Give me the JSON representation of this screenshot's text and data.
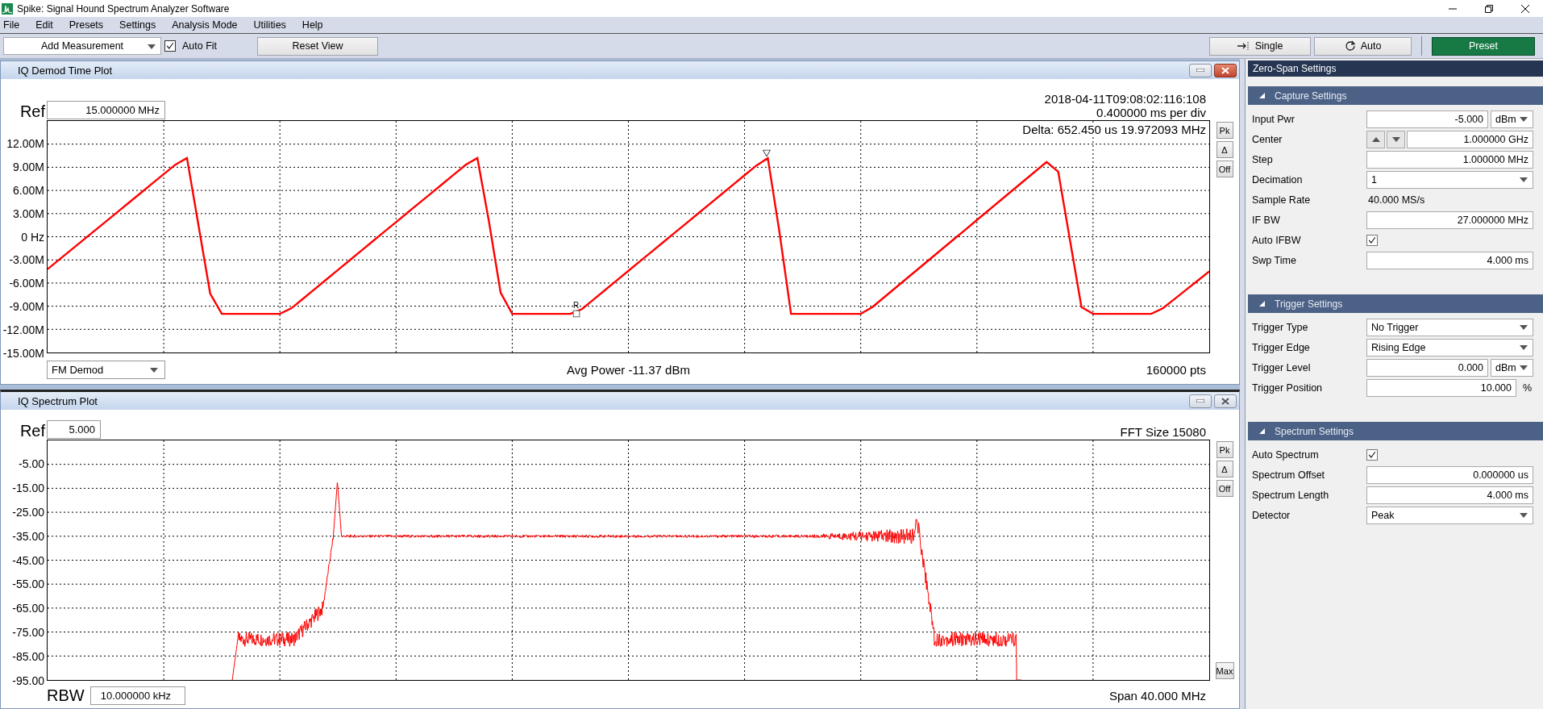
{
  "window": {
    "title": "Spike: Signal Hound Spectrum Analyzer Software"
  },
  "menu": [
    "File",
    "Edit",
    "Presets",
    "Settings",
    "Analysis Mode",
    "Utilities",
    "Help"
  ],
  "toolbar": {
    "measurement": "Add Measurement",
    "auto_fit": {
      "label": "Auto Fit",
      "checked": true
    },
    "reset": "Reset View",
    "single": "Single",
    "auto": "Auto",
    "preset": "Preset"
  },
  "plots": [
    {
      "title": "IQ Demod Time Plot",
      "active": true,
      "ref_label": "Ref",
      "ref_value": "15.000000 MHz",
      "header_lines": [
        "2018-04-11T09:08:02:116:108",
        "0.400000 ms per div"
      ],
      "annotation": "Delta: 652.450 us 19.972093 MHz",
      "chart_data": {
        "type": "line",
        "grid": true,
        "categories": [
          null,
          null,
          null,
          null,
          null,
          null,
          null,
          null,
          null,
          null,
          null,
          null,
          null,
          null,
          null,
          null,
          null,
          null,
          null,
          null,
          null,
          null,
          null,
          null,
          null,
          null,
          null,
          null,
          null,
          null,
          null,
          null,
          null,
          null,
          null,
          null,
          null,
          null,
          null,
          null,
          null,
          null,
          null,
          null,
          null,
          null,
          null,
          null,
          null,
          null,
          null,
          null,
          null,
          null,
          null,
          null,
          null,
          null,
          null,
          null,
          null,
          null,
          null,
          null,
          null,
          null,
          null,
          null,
          null,
          null,
          null,
          null,
          null,
          null,
          null,
          null,
          null,
          null,
          null,
          null,
          null,
          null,
          null,
          null,
          null,
          null,
          null,
          null,
          null,
          null,
          null,
          null,
          null,
          null,
          null,
          null,
          null,
          null,
          null,
          null,
          null
        ],
        "ylim": [
          -15000000,
          15000000
        ],
        "yticks": [
          {
            "value": 12000000,
            "label": "12.00M"
          },
          {
            "value": 9000000,
            "label": "9.00M"
          },
          {
            "value": 6000000,
            "label": "6.00M"
          },
          {
            "value": 3000000,
            "label": "3.00M"
          },
          {
            "value": 0,
            "label": "0 Hz"
          },
          {
            "value": -3000000,
            "label": "-3.00M"
          },
          {
            "value": -6000000,
            "label": "-6.00M"
          },
          {
            "value": -9000000,
            "label": "-9.00M"
          },
          {
            "value": -12000000,
            "label": "-12.00M"
          },
          {
            "value": -15000000,
            "label": "-15.00M"
          }
        ],
        "series": [
          {
            "color": "#ff0000",
            "values": [
              -4200000,
              -2970000,
              -1740000,
              -510000,
              720000,
              1950000,
              3180000,
              4420000,
              5650000,
              6880000,
              8110000,
              9340000,
              10200000,
              1420000,
              -7370000,
              -10000000,
              -10000000,
              -10000000,
              -10000000,
              -10000000,
              -10000000,
              -9260000,
              -8020000,
              -6780000,
              -5540000,
              -4300000,
              -3060000,
              -1820000,
              -580000,
              660000,
              1900000,
              3140000,
              4380000,
              5610000,
              6850000,
              8090000,
              9330000,
              10200000,
              1940000,
              -7250000,
              -10000000,
              -10000000,
              -10000000,
              -10000000,
              -10000000,
              -10000000,
              -9380000,
              -8140000,
              -6900000,
              -5660000,
              -4420000,
              -3180000,
              -1940000,
              -710000,
              530000,
              1770000,
              3010000,
              4250000,
              5490000,
              6730000,
              7970000,
              9210000,
              10200000,
              630000,
              -10000000,
              -10000000,
              -10000000,
              -10000000,
              -10000000,
              -10000000,
              -10000000,
              -9120000,
              -7870000,
              -6610000,
              -5360000,
              -4100000,
              -2850000,
              -1590000,
              -340000,
              910000,
              2170000,
              3420000,
              4680000,
              5930000,
              7190000,
              8440000,
              9700000,
              8440000,
              -340000,
              -9120000,
              -10000000,
              -10000000,
              -10000000,
              -10000000,
              -10000000,
              -10000000,
              -9280000,
              -8090000,
              -6890000,
              -5700000,
              -4500000
            ]
          }
        ]
      },
      "side_buttons": [
        "Pk",
        "Δ",
        "Off"
      ],
      "markers": [
        {
          "kind": "reference",
          "label": "R"
        },
        {
          "kind": "delta"
        }
      ],
      "footer": {
        "kind": "select",
        "value": "FM Demod"
      },
      "footer_center": "Avg Power -11.37 dBm",
      "footer_right": "160000 pts"
    },
    {
      "title": "IQ Spectrum Plot",
      "active": false,
      "ref_label": "Ref",
      "ref_value": "5.000",
      "header_lines": [
        "FFT Size 15080"
      ],
      "yticks": [
        "-5.00",
        "-15.00",
        "-25.00",
        "-35.00",
        "-45.00",
        "-55.00",
        "-65.00",
        "-75.00",
        "-85.00",
        "-95.00"
      ],
      "side_buttons": [
        "Pk",
        "Δ",
        "Off"
      ],
      "bottom_button": "Max",
      "kind": "spectrum",
      "footer": {
        "kind": "field",
        "label": "RBW",
        "value": "10.000000 kHz"
      },
      "footer_right": "Span 40.000 MHz"
    }
  ],
  "settings": {
    "title": "Zero-Span Settings",
    "sections": [
      {
        "title": "Capture Settings",
        "expanded": true,
        "rows": [
          {
            "kind": "input",
            "label": "Input Pwr",
            "value": "-5.000",
            "unit": "dBm"
          },
          {
            "kind": "spin",
            "label": "Center",
            "value": "1.000000 GHz"
          },
          {
            "kind": "input",
            "label": "Step",
            "value": "1.000000 MHz"
          },
          {
            "kind": "select",
            "label": "Decimation",
            "value": "1"
          },
          {
            "kind": "text",
            "label": "Sample Rate",
            "value": "40.000 MS/s"
          },
          {
            "kind": "input",
            "label": "IF BW",
            "value": "27.000000 MHz"
          },
          {
            "kind": "checkbox",
            "label": "Auto IFBW",
            "checked": true
          },
          {
            "kind": "input",
            "label": "Swp Time",
            "value": "4.000 ms"
          }
        ]
      },
      {
        "title": "Trigger Settings",
        "expanded": true,
        "rows": [
          {
            "kind": "select",
            "label": "Trigger Type",
            "value": "No Trigger"
          },
          {
            "kind": "select",
            "label": "Trigger Edge",
            "value": "Rising Edge"
          },
          {
            "kind": "input",
            "label": "Trigger Level",
            "value": "0.000",
            "unit": "dBm"
          },
          {
            "kind": "input",
            "label": "Trigger Position",
            "value": "10.000",
            "suffix": "%"
          }
        ]
      },
      {
        "title": "Spectrum Settings",
        "expanded": true,
        "rows": [
          {
            "kind": "checkbox",
            "label": "Auto Spectrum",
            "checked": true
          },
          {
            "kind": "input",
            "label": "Spectrum Offset",
            "value": "0.000000 us"
          },
          {
            "kind": "input",
            "label": "Spectrum Length",
            "value": "4.000 ms"
          },
          {
            "kind": "select",
            "label": "Detector",
            "value": "Peak"
          }
        ]
      }
    ]
  }
}
